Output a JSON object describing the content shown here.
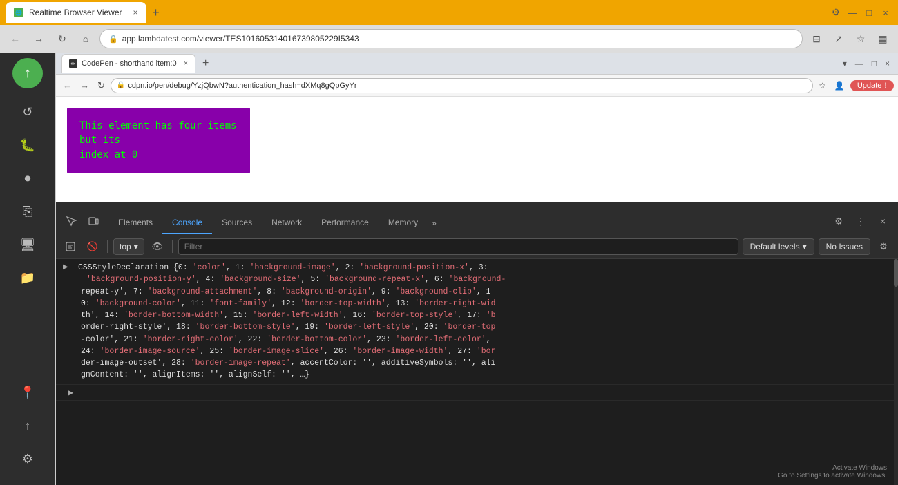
{
  "titleBar": {
    "tabLabel": "Realtime Browser Viewer",
    "closeBtn": "×",
    "newTabBtn": "+",
    "minimizeBtn": "—",
    "maximizeBtn": "□",
    "windowCloseBtn": "×"
  },
  "addressBar": {
    "url": "app.lambdatest.com/viewer/TES101605314016739805229I5343",
    "backBtn": "←",
    "forwardBtn": "→",
    "refreshBtn": "↻",
    "homeBtn": "⌂"
  },
  "sidebar": {
    "logoIcon": "↑",
    "items": [
      {
        "name": "refresh-icon",
        "icon": "↺"
      },
      {
        "name": "bug-icon",
        "icon": "🐛"
      },
      {
        "name": "video-icon",
        "icon": "⏺"
      },
      {
        "name": "copy-icon",
        "icon": "⎘"
      },
      {
        "name": "monitor-icon",
        "icon": "🖥"
      },
      {
        "name": "folder-icon",
        "icon": "📁"
      },
      {
        "name": "location-icon",
        "icon": "📍"
      },
      {
        "name": "upload-icon",
        "icon": "↑"
      }
    ],
    "settingsIcon": "⚙"
  },
  "innerBrowser": {
    "tabLabel": "CodePen - shorthand item:0",
    "innerUrl": "cdpn.io/pen/debug/YzjQbwN?authentication_hash=dXMq8gQpGyYr",
    "updateBtn": "Update",
    "updateAlert": "!"
  },
  "webContent": {
    "demoText1": "This element has four items but its",
    "demoText2": "index at 0"
  },
  "devtools": {
    "tabs": [
      {
        "name": "Elements",
        "label": "Elements",
        "active": false
      },
      {
        "name": "Console",
        "label": "Console",
        "active": true
      },
      {
        "name": "Sources",
        "label": "Sources",
        "active": false
      },
      {
        "name": "Network",
        "label": "Network",
        "active": false
      },
      {
        "name": "Performance",
        "label": "Performance",
        "active": false
      },
      {
        "name": "Memory",
        "label": "Memory",
        "active": false
      }
    ],
    "moreTabsLabel": "»",
    "toolbar": {
      "contextLabel": "top",
      "filterPlaceholder": "Filter",
      "defaultLevelsLabel": "Default levels",
      "noIssuesLabel": "No Issues"
    },
    "consoleOutput": {
      "mainText": "CSSStyleDeclaration {0: 'color', 1: 'background-image', 2: 'background-position-x', 3: 'background-position-y', 4: 'background-size', 5: 'background-repeat-x', 6: 'background-repeat-y', 7: 'background-attachment', 8: 'background-origin', 9: 'background-clip', 10: 'background-color', 11: 'font-family', 12: 'border-top-width', 13: 'border-right-width', 14: 'border-bottom-width', 15: 'border-left-width', 16: 'border-top-style', 17: 'border-right-style', 18: 'border-bottom-style', 19: 'border-left-style', 20: 'border-top-color', 21: 'border-right-color', 22: 'border-bottom-color', 23: 'border-left-color', 24: 'border-image-source', 25: 'border-image-slice', 26: 'border-image-width', 27: 'border-image-outset', 28: 'border-image-repeat', accentColor: '', additiveSymbols: '', alignContent: '', alignItems: '', alignSelf: '', …}"
    },
    "activateWindows": {
      "line1": "Activate Windows",
      "line2": "Go to Settings to activate Windows."
    }
  },
  "colors": {
    "accent": "#f0a500",
    "devtoolsTabActive": "#4da6ff",
    "consoleText": "#e06c75",
    "demoBackground": "#8800aa",
    "demoText": "#00ff00"
  }
}
